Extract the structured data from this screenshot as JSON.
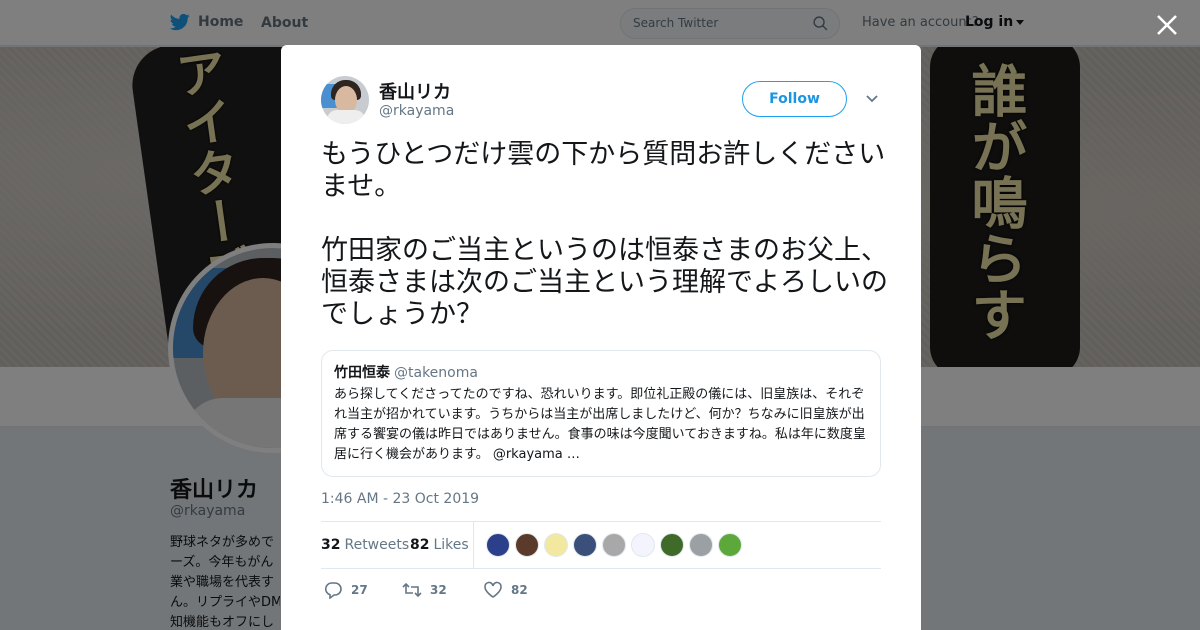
{
  "nav": {
    "home_label": "Home",
    "about_label": "About",
    "search_placeholder": "Search Twitter",
    "account_prompt": "Have an account?",
    "login_label": "Log in"
  },
  "background_profile": {
    "name": "香山リカ",
    "handle": "@rkayama",
    "bio": "野球ネタが多めで\nーズ。今年もがん\n業や職場を代表す\nん。リプライやDM\n知機能もオフにし",
    "banner_text_left": "アイターズ",
    "banner_text_right": "誰が鳴らす"
  },
  "tweet": {
    "author_name": "香山リカ",
    "author_handle": "@rkayama",
    "follow_label": "Follow",
    "text": "もうひとつだけ雲の下から質問お許しくださいませ。\n\n竹田家のご当主というのは恒泰さまのお父上、恒泰さまは次のご当主という理解でよろしいのでしょうか？",
    "quote": {
      "name": "竹田恒泰",
      "handle": "@takenoma",
      "text": "あら探してくださってたのですね、恐れいります。即位礼正殿の儀には、旧皇族は、それぞれ当主が招かれています。うちからは当主が出席しましたけど、何か？ちなみに旧皇族が出席する饗宴の儀は昨日ではありません。食事の味は今度聞いておきますね。私は年に数度皇居に行く機会があります。 @rkayama …"
    },
    "timestamp": "1:46 AM - 23 Oct 2019",
    "retweets_count": "32",
    "retweets_label": "Retweets",
    "likes_count": "82",
    "likes_label": "Likes",
    "reply_count": "27",
    "retweet_action_count": "32",
    "like_action_count": "82"
  },
  "liker_avatar_colors": [
    "#2b3f8a",
    "#5a3a2a",
    "#f2e8a0",
    "#3a4f7a",
    "#a8a8a8",
    "#f4f4ff",
    "#3f6a2a",
    "#9aa0a4",
    "#5da83a"
  ],
  "colors": {
    "brand_blue": "#1da1f2",
    "text_primary": "#14171a",
    "text_secondary": "#657786",
    "border": "#e1e8ed"
  }
}
